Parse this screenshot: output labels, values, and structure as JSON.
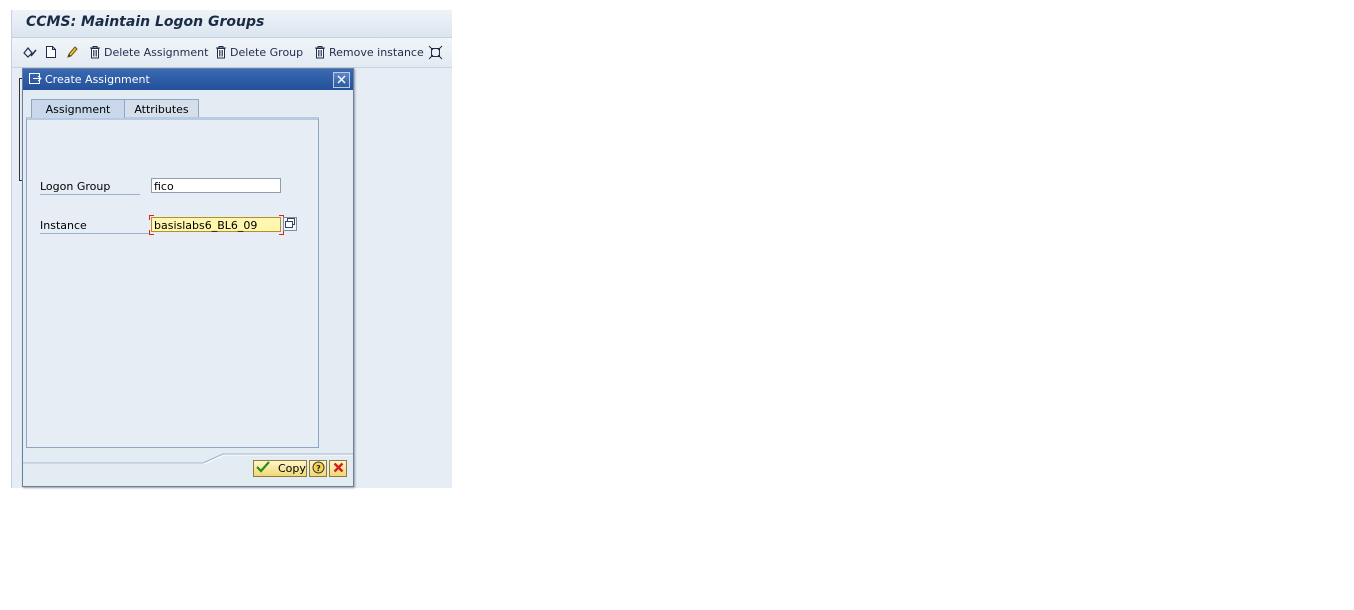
{
  "app": {
    "title": "CCMS: Maintain Logon Groups"
  },
  "toolbar": {
    "display_change_icon": "display-change-icon",
    "create_icon": "new-document-icon",
    "change_icon": "pencil-icon",
    "delete_assignment": "Delete Assignment",
    "delete_group": "Delete Group",
    "remove_instance": "Remove instance",
    "expand_icon": "expand-icon"
  },
  "dialog": {
    "title": "Create Assignment",
    "tabs": [
      {
        "label": "Assignment",
        "active": true
      },
      {
        "label": "Attributes",
        "active": false
      }
    ],
    "fields": {
      "logon_group_label": "Logon Group",
      "logon_group_value": "fico",
      "instance_label": "Instance",
      "instance_value": "basislabs6_BL6_09"
    },
    "buttons": {
      "copy": "Copy",
      "help_icon": "help-icon",
      "cancel_icon": "cancel-icon"
    }
  },
  "colors": {
    "title_bar": "#2c5aa3",
    "required_field": "#fff7ad",
    "background": "#e3ebf3"
  }
}
